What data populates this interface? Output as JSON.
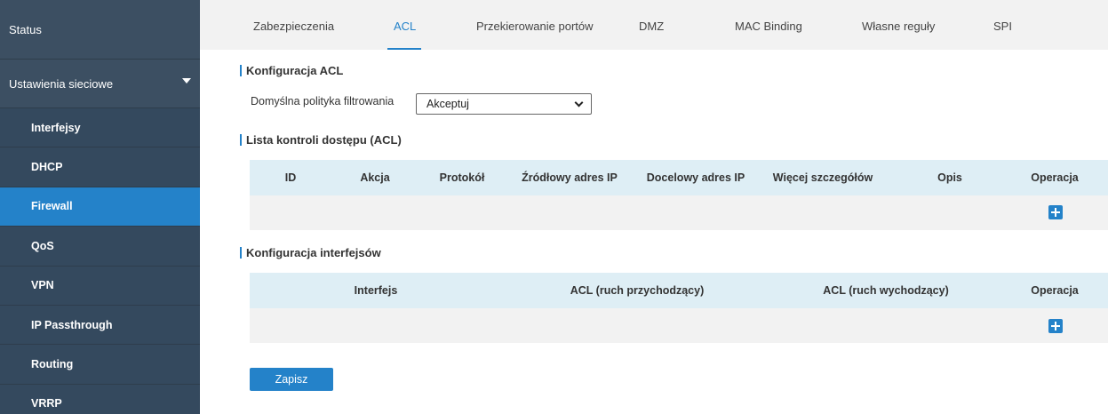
{
  "sidebar": {
    "status": "Status",
    "network_settings": "Ustawienia sieciowe",
    "items": [
      "Interfejsy",
      "DHCP",
      "Firewall",
      "QoS",
      "VPN",
      "IP Passthrough",
      "Routing",
      "VRRP"
    ],
    "active_item": "Firewall"
  },
  "tabs": {
    "items": [
      "Zabezpieczenia",
      "ACL",
      "Przekierowanie portów",
      "DMZ",
      "MAC Binding",
      "Własne reguły",
      "SPI"
    ],
    "active": "ACL"
  },
  "acl_config": {
    "title": "Konfiguracja ACL",
    "default_policy_label": "Domyślna polityka filtrowania",
    "default_policy_value": "Akceptuj"
  },
  "acl_list": {
    "title": "Lista kontroli dostępu (ACL)",
    "columns": [
      "ID",
      "Akcja",
      "Protokół",
      "Źródłowy adres IP",
      "Docelowy adres IP",
      "Więcej szczegółów",
      "Opis",
      "Operacja"
    ]
  },
  "interface_config": {
    "title": "Konfiguracja interfejsów",
    "columns": [
      "Interfejs",
      "ACL (ruch przychodzący)",
      "ACL (ruch wychodzący)",
      "Operacja"
    ]
  },
  "save_label": "Zapisz",
  "colors": {
    "sidebar_bg": "#3c4f62",
    "accent": "#2482c9",
    "table_header_bg": "#deeef5",
    "tabbar_bg": "#f2f2f2"
  },
  "icons": {
    "expand": "caret-down-icon",
    "add": "plus-icon",
    "select": "chevron-down-icon"
  }
}
